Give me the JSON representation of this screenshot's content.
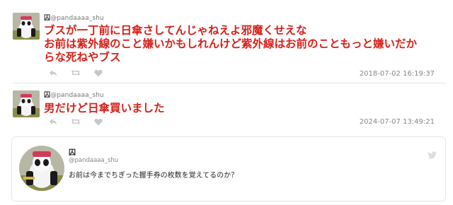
{
  "posts": [
    {
      "name": "囚",
      "handle": "@pandaaaa_shu",
      "text": "ブスが一丁前に日傘さしてんじゃねえよ邪魔くせえな\nお前は紫外線のこと嫌いかもしれんけど紫外線はお前のこともっと嫌いだからな死ねやブス",
      "lines": [
        "ブスが一丁前に日傘さしてんじゃねえよ邪魔くせえな",
        "お前は紫外線のこと嫌いかもしれんけど紫外線はお前のこともっと嫌いだか",
        "らな死ねやブス"
      ],
      "timestamp": "2018-07-02 16:19:37"
    },
    {
      "name": "囚",
      "handle": "@pandaaaa_shu",
      "lines": [
        "男だけど日傘買いました"
      ],
      "timestamp": "2024-07-07 13:49:21"
    }
  ],
  "quote_card": {
    "name": "囚",
    "handle": "@pandaaaa_shu",
    "text": "お前は今までちぎった握手券の枚数を覚えてるのか？"
  },
  "icons": {
    "reply": "reply-icon",
    "retweet": "retweet-icon",
    "like": "heart-icon",
    "twitter": "twitter-bird-icon"
  },
  "colors": {
    "tweet_text": "#d7201a",
    "muted": "#888888"
  }
}
